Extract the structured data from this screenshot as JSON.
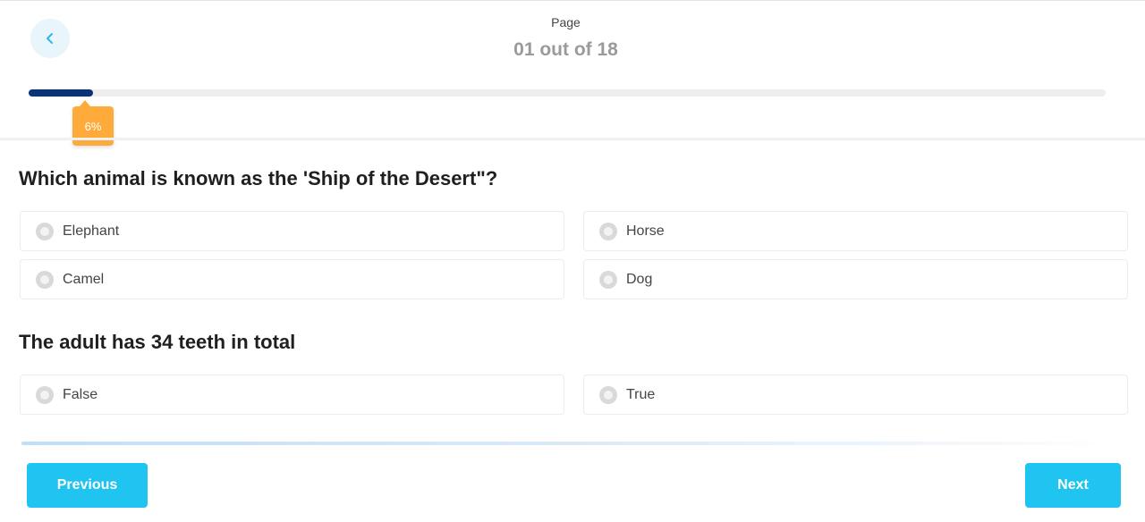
{
  "header": {
    "page_label": "Page",
    "page_counter": "01 out of 18",
    "progress_percent": 6,
    "progress_badge": "6%"
  },
  "colors": {
    "progress_fill": "#0b3476",
    "badge": "#ffab3c",
    "accent_button": "#20c4f0",
    "back_button_bg": "#e8f6fc"
  },
  "questions": [
    {
      "title": "Which animal is known as the 'Ship of the Desert\"?",
      "options": [
        "Elephant",
        "Horse",
        "Camel",
        "Dog"
      ]
    },
    {
      "title": "The adult has 34 teeth in total",
      "options": [
        "False",
        "True"
      ]
    }
  ],
  "footer": {
    "previous_label": "Previous",
    "next_label": "Next"
  },
  "icons": {
    "back": "chevron-left-icon",
    "radio": "radio-unselected-icon"
  }
}
